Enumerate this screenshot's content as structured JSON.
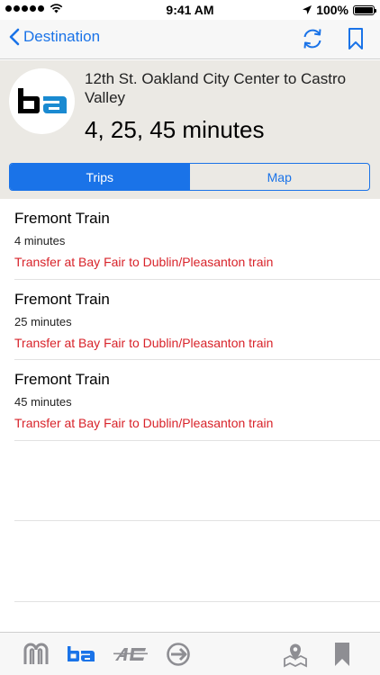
{
  "status_bar": {
    "time": "9:41 AM",
    "battery_label": "100%",
    "battery_level": 1.0
  },
  "nav": {
    "back_label": "Destination",
    "icons": [
      "refresh-icon",
      "bookmark-icon"
    ],
    "accent_color": "#1a73e8"
  },
  "header": {
    "logo_text": "ba",
    "route": "12th St. Oakland City Center to Castro Valley",
    "times": "4, 25, 45 minutes"
  },
  "segments": {
    "items": [
      "Trips",
      "Map"
    ],
    "selected": "Trips"
  },
  "trips": [
    {
      "title": "Fremont Train",
      "duration": "4 minutes",
      "transfer": "Transfer at Bay Fair to Dublin/Pleasanton train"
    },
    {
      "title": "Fremont Train",
      "duration": "25 minutes",
      "transfer": "Transfer at Bay Fair to Dublin/Pleasanton train"
    },
    {
      "title": "Fremont Train",
      "duration": "45 minutes",
      "transfer": "Transfer at Bay Fair to Dublin/Pleasanton train"
    }
  ],
  "tab_bar": {
    "tabs": [
      "muni-tab",
      "bart-tab",
      "ac-transit-tab",
      "caltrain-tab",
      "nearby-tab",
      "bookmarks-tab"
    ],
    "selected": "bart-tab",
    "transfer_color": "#d8232a"
  }
}
